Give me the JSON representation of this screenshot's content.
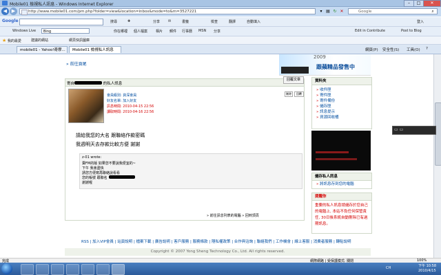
{
  "window": {
    "title": "Mobile01 檢視私人訊息 - Windows Internet Explorer",
    "minimize": "–",
    "maximize": "□",
    "close": "✕"
  },
  "address": {
    "url": "http://www.mobile01.com/pm.php?folder=view&location=inbox&mode=to&m=3527221",
    "search_engine": "Google"
  },
  "google_toolbar": {
    "label": "Google",
    "items": [
      "搜尋",
      "✚",
      "分享",
      "✉",
      "書籤",
      "檢查",
      "翻譯",
      "自動填入",
      "登入"
    ]
  },
  "wl_toolbar": {
    "label": "Windows Live",
    "search": "Bing",
    "items": [
      "你在哪裡",
      "個人檔案",
      "相片",
      "郵件",
      "行事曆",
      "MSN",
      "分享",
      "Edit in Contribute",
      "Post to Blog"
    ]
  },
  "favorites": {
    "label": "我的最愛",
    "items": [
      "建議的網站",
      "網頁快訊圖庫"
    ]
  },
  "tabs": [
    {
      "label": "mobile01 - Yahoo!奇摩..."
    },
    {
      "label": "Mobile01 檢視私人訊息"
    }
  ],
  "command_bar": {
    "items": [
      "網頁(P)",
      "安全性(S)",
      "工具(O)",
      "?"
    ]
  },
  "page": {
    "top_link": "前往頁尾",
    "panel_title_suffix": "的私人訊息",
    "reply_button": "回覆文章",
    "small_buttons": [
      "刪除",
      "回覆"
    ],
    "meta": [
      {
        "label": "會員級別:",
        "value": "資深會員"
      },
      {
        "label": "好友名單:",
        "value": "加入好友"
      },
      {
        "label": "訊息時間:",
        "value": "2010-04-15 22:56"
      },
      {
        "label": "讀取時間:",
        "value": "2010-04-16 22:56"
      }
    ],
    "message_lines": [
      "請給我您的大名 跟聯絡作款密碼",
      "我週明天去存款比較方便 謝謝"
    ],
    "quote": {
      "header": "z-01 wrote:",
      "lines": [
        "賣FM的版 如果您不要說我便宜的~",
        "下午 我會盡快",
        "請您方便寫再聯絡說看看",
        "您的帳號 跟聯名",
        "謝謝喔"
      ]
    },
    "bottom_links": "» 前往訊息列表的電腦 » 回到頂頁",
    "footer_links": "RSS | 加入VIP會員 | 站頁說明 | 檔案下載 | 廣告說明 | 客戶服務 | 服務條款 | 隱私權政策 | 合作與洽詢 | 聯絡我們 | 工作機會 | 線上客服 | 消費者服務 | 轉貼說明",
    "copyright": "Copyright © 2007 Yong Sheng Technology Co., Ltd. All rights reserved.",
    "ad_text": "跟蘋精品發售中",
    "ad_num": "2009"
  },
  "sidebar": {
    "box1_title": "資料夾",
    "box1_items": [
      "收件匣",
      "寄件匣",
      "寄件備份",
      "儲存匣",
      "訊息提示",
      "資源回收桶"
    ],
    "box2_title": "儲存私人訊息",
    "box2_items": [
      "將訊息存到您的電腦"
    ],
    "box3_title": "提醒你",
    "box3_text": "重要的私人訊息請儲存於您自己的電腦上, 本站不負任何保管責任, 30日後系統自動刪除已有過期訊息。"
  },
  "status": {
    "left": "完成",
    "zone": "網際網路 | 受保護模式: 關閉",
    "zoom": "100%"
  },
  "taskbar": {
    "lang": "CH",
    "time": "下午 10:58",
    "date": "2010/4/15"
  },
  "colors": {
    "accent": "#004da0",
    "red": "#d40000",
    "panel_border": "#cfd8c8",
    "panel_head": "#eef2ea"
  }
}
